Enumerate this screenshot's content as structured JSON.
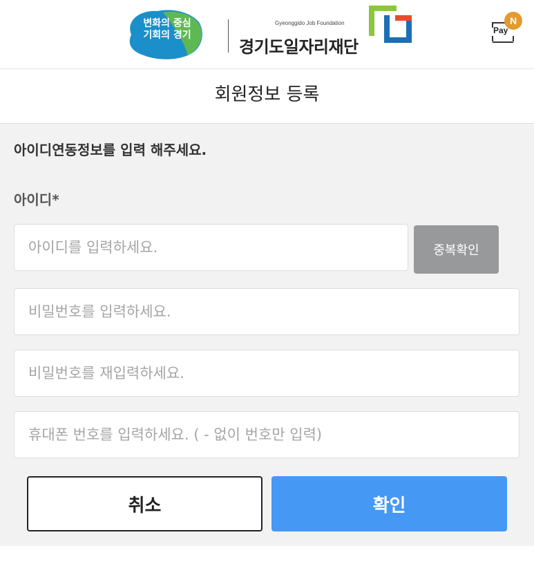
{
  "header": {
    "logo_slogan_line1": "변화의 중심",
    "logo_slogan_line2": "기회의 경기",
    "logo_english": "Gyeonggido Job Foundation",
    "logo_korean": "경기도일자리재단",
    "pay_label": "Pay",
    "pay_badge": "N"
  },
  "page": {
    "title": "회원정보 등록"
  },
  "form": {
    "instruction": "아이디연동정보를 입력 해주세요.",
    "id_label": "아이디*",
    "id_placeholder": "아이디를 입력하세요.",
    "duplicate_check_label": "중복확인",
    "password_placeholder": "비밀번호를 입력하세요.",
    "password_confirm_placeholder": "비밀번호를 재입력하세요.",
    "phone_placeholder": "휴대폰 번호를 입력하세요. ( - 없이 번호만 입력)"
  },
  "actions": {
    "cancel_label": "취소",
    "confirm_label": "확인"
  },
  "colors": {
    "confirm_button": "#4698f5",
    "duplicate_button": "#98999b",
    "background": "#f2f2f2",
    "pay_badge": "#e29b2c"
  }
}
